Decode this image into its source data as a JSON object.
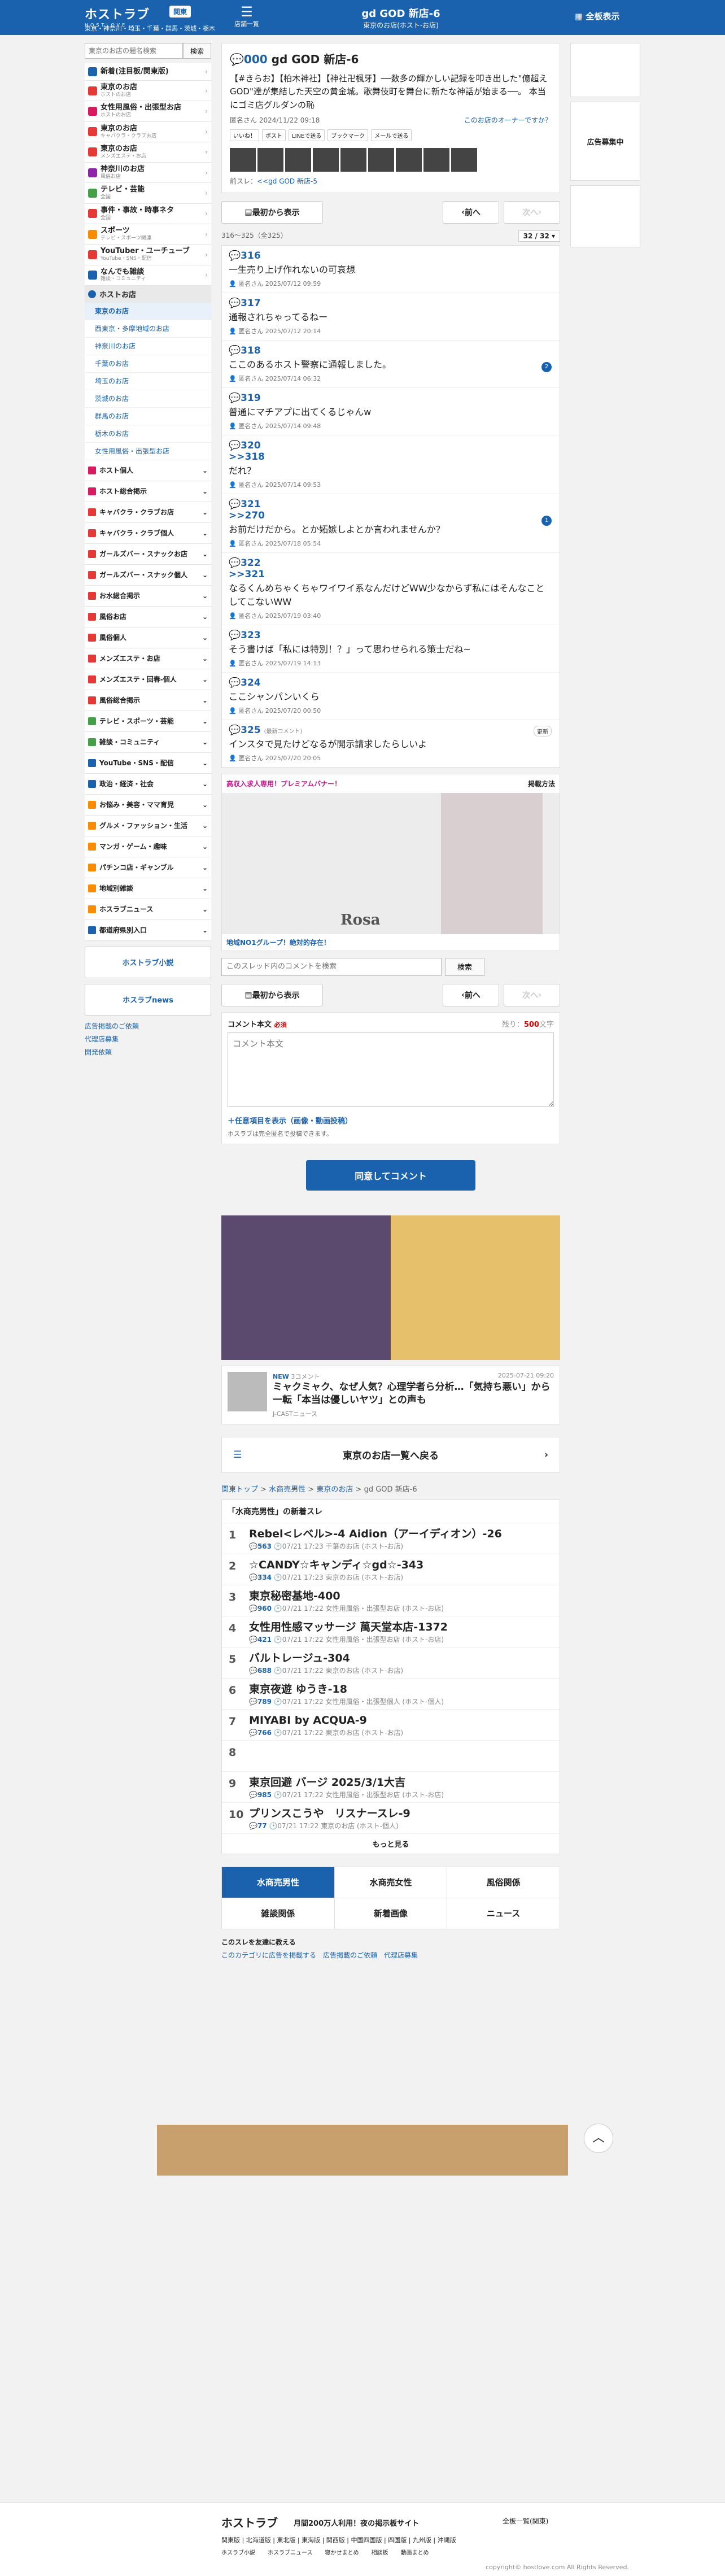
{
  "header": {
    "logo": "ホストラブ",
    "logo_sub": "HOSTLOVE",
    "area_badge": "関東",
    "areas": "東京・神奈川・埼玉・千葉・群馬・茨城・栃木",
    "menu_label": "店舗一覧",
    "title": "gd GOD 新店-6",
    "subtitle": "東京のお店(ホスト-お店)",
    "board": "全板表示"
  },
  "sidebar": {
    "search_placeholder": "東京のお店の題名検索",
    "search_btn": "検索",
    "categories": [
      {
        "name": "新着(注目板/関東版)",
        "color": "#1b62ae"
      },
      {
        "name": "東京のお店",
        "sub": "ホストのお店",
        "color": "#e53935"
      },
      {
        "name": "女性用風俗・出張型お店",
        "sub": "ホストのお店",
        "color": "#d81b60"
      },
      {
        "name": "東京のお店",
        "sub": "キャバクラ・クラブお店",
        "color": "#e53935"
      },
      {
        "name": "東京のお店",
        "sub": "メンズエステ・お店",
        "color": "#e53935"
      },
      {
        "name": "神奈川のお店",
        "sub": "風俗お店",
        "color": "#8e24aa"
      },
      {
        "name": "テレビ・芸能",
        "sub": "全国",
        "color": "#43a047"
      },
      {
        "name": "事件・事故・時事ネタ",
        "sub": "全国",
        "color": "#e53935"
      },
      {
        "name": "スポーツ",
        "sub": "テレビ・スポーツ関連",
        "color": "#fb8c00"
      },
      {
        "name": "YouTuber・ユーチューブ",
        "sub": "YouTube・SNS・配信",
        "color": "#e53935"
      },
      {
        "name": "なんでも雑談",
        "sub": "雑談・コミュニティ",
        "color": "#1b62ae"
      }
    ],
    "host_group": "ホストお店",
    "host_items": [
      "東京のお店",
      "西東京・多摩地域のお店",
      "神奈川のお店",
      "千葉のお店",
      "埼玉のお店",
      "茨城のお店",
      "群馬のお店",
      "栃木のお店",
      "女性用風俗・出張型お店"
    ],
    "groups": [
      {
        "name": "ホスト個人",
        "color": "#d81b60"
      },
      {
        "name": "ホスト総合掲示",
        "color": "#d81b60"
      },
      {
        "name": "キャバクラ・クラブお店",
        "color": "#e53935"
      },
      {
        "name": "キャバクラ・クラブ個人",
        "color": "#e53935"
      },
      {
        "name": "ガールズバー・スナックお店",
        "color": "#e53935"
      },
      {
        "name": "ガールズバー・スナック個人",
        "color": "#e53935"
      },
      {
        "name": "お水総合掲示",
        "color": "#e53935"
      },
      {
        "name": "風俗お店",
        "color": "#e53935"
      },
      {
        "name": "風俗個人",
        "color": "#e53935"
      },
      {
        "name": "メンズエステ・お店",
        "color": "#e53935"
      },
      {
        "name": "メンズエステ・回春-個人",
        "color": "#e53935"
      },
      {
        "name": "風俗総合掲示",
        "color": "#e53935"
      },
      {
        "name": "テレビ・スポーツ・芸能",
        "color": "#43a047"
      },
      {
        "name": "雑談・コミュニティ",
        "color": "#43a047"
      },
      {
        "name": "YouTube・SNS・配信",
        "color": "#1b62ae"
      },
      {
        "name": "政治・経済・社会",
        "color": "#1b62ae"
      },
      {
        "name": "お悩み・美容・ママ育児",
        "color": "#fb8c00"
      },
      {
        "name": "グルメ・ファッション・生活",
        "color": "#fb8c00"
      },
      {
        "name": "マンガ・ゲーム・趣味",
        "color": "#fb8c00"
      },
      {
        "name": "パチンコ店・ギャンブル",
        "color": "#fb8c00"
      },
      {
        "name": "地域別雑談",
        "color": "#fb8c00"
      },
      {
        "name": "ホスラブニュース",
        "color": "#fb8c00"
      },
      {
        "name": "都道府県別入口",
        "color": "#1b62ae"
      }
    ],
    "banner1": "ホストラブ小説",
    "banner2": "ホスラブnews",
    "links": [
      "広告掲載のご依頼",
      "代理店募集",
      "開発依頼"
    ]
  },
  "thread": {
    "number": "000",
    "title": "gd GOD 新店-6",
    "intro": "【#きらお】【柏木神社】【神社卍楓牙】──数多の輝かしい記録を叩き出した\"億超えGOD\"達が集結した天空の黄金城。歌舞伎町を舞台に新たな神話が始まる──。 本当にゴミ店グルダンの恥",
    "author": "匿名さん 2024/11/22 09:18",
    "owner": "このお店のオーナーですか？",
    "share": [
      "いいね！",
      "ポスト",
      "LINEで送る",
      "ブックマーク",
      "メールで送る"
    ],
    "prev_label": "前スレ",
    "prev_link": "<<gd GOD 新店-5"
  },
  "nav": {
    "first": "最初から表示",
    "prev": "前へ",
    "next": "次へ"
  },
  "count": {
    "text": "316〜325（全325）",
    "page": "32 / 32"
  },
  "posts": [
    {
      "no": "316",
      "body": "一生売り上げ作れないの可哀想",
      "info": "匿名さん 2025/07/12 09:59"
    },
    {
      "no": "317",
      "body": "通報されちゃってるねー",
      "info": "匿名さん 2025/07/12 20:14"
    },
    {
      "no": "318",
      "body": "ここのあるホスト警察に通報しました。",
      "info": "匿名さん 2025/07/14 06:32",
      "badge": "2"
    },
    {
      "no": "319",
      "body": "普通にマチアプに出てくるじゃんw",
      "info": "匿名さん 2025/07/14 09:48"
    },
    {
      "no": "320",
      "anchor": ">>318",
      "body": "だれ？",
      "info": "匿名さん 2025/07/14 09:53"
    },
    {
      "no": "321",
      "anchor": ">>270",
      "body": "お前だけだから。とか妬嫉しよとか言われませんか？",
      "info": "匿名さん 2025/07/18 05:54",
      "badge": "1"
    },
    {
      "no": "322",
      "anchor": ">>321",
      "body": "なるくんめちゃくちゃワイワイ系なんだけどWW少なからず私にはそんなことしてこないWW",
      "info": "匿名さん 2025/07/19 03:40"
    },
    {
      "no": "323",
      "body": "そう書けば「私には特別！？」って思わせられる策士だね~",
      "info": "匿名さん 2025/07/19 14:13"
    },
    {
      "no": "324",
      "body": "ここシャンパンいくら",
      "info": "匿名さん 2025/07/20 00:50"
    },
    {
      "no": "325",
      "note": "(最新コメント)",
      "body": "インスタで見たけどなるが開示請求したらしいよ",
      "info": "匿名さん 2025/07/20 20:05",
      "tag": "更新"
    }
  ],
  "ad": {
    "title": "高収入求人専用！プレミアムバナー！",
    "link": "掲載方法",
    "rosa": "Rosa",
    "footer": "地域NO1グループ！絶対的存在！"
  },
  "thread_search": {
    "placeholder": "このスレッド内のコメントを検索",
    "btn": "検索"
  },
  "comment": {
    "label": "コメント本文",
    "req": "必須",
    "remain": "残り：",
    "remain_num": "500",
    "unit": "文字",
    "placeholder": "コメント本文",
    "opt": "任意項目を表示（画像・動画投稿）",
    "note": "ホスラブは完全匿名で投稿できます。",
    "submit": "同意してコメント"
  },
  "news": {
    "badge": "NEW",
    "title": "ミャクミャク、なぜ人気？心理学者ら分析…「気持ち悪い」から一転「本当は優しいヤツ」との声も",
    "src": "J-CASTニュース",
    "date": "2025-07-21 09:20",
    "count": "3コメント"
  },
  "back": "東京のお店一覧へ戻る",
  "breadcrumb": [
    "関東トップ",
    "水商売男性",
    "東京のお店",
    "gd GOD 新店-6"
  ],
  "ranking": {
    "title": "「水商売男性」の新着スレ",
    "items": [
      {
        "n": "1",
        "t": "Rebel<レベル>-4 Aidion（アーイディオン）-26",
        "c": "563",
        "d": "07/21 17:23",
        "cat": "千葉のお店 (ホスト-お店)"
      },
      {
        "n": "2",
        "t": "☆CANDY☆キャンディ☆gd☆-343",
        "c": "334",
        "d": "07/21 17:23",
        "cat": "東京のお店 (ホスト-お店)"
      },
      {
        "n": "3",
        "t": "東京秘密基地-400",
        "c": "960",
        "d": "07/21 17:22",
        "cat": "女性用風俗・出張型お店 (ホスト-お店)"
      },
      {
        "n": "4",
        "t": "女性用性感マッサージ 萬天堂本店-1372",
        "c": "421",
        "d": "07/21 17:22",
        "cat": "女性用風俗・出張型お店 (ホスト-お店)"
      },
      {
        "n": "5",
        "t": "バルトレージュ-304",
        "c": "688",
        "d": "07/21 17:22",
        "cat": "東京のお店 (ホスト-お店)"
      },
      {
        "n": "6",
        "t": "東京夜遊 ゆうき-18",
        "c": "789",
        "d": "07/21 17:22",
        "cat": "女性用風俗・出張型個人 (ホスト-個人)"
      },
      {
        "n": "7",
        "t": "MIYABI by ACQUA-9",
        "c": "766",
        "d": "07/21 17:22",
        "cat": "東京のお店 (ホスト-お店)"
      },
      {
        "n": "8",
        "t": "",
        "c": "",
        "d": "",
        "cat": ""
      },
      {
        "n": "9",
        "t": "東京回避 バージ 2025/3/1大吉",
        "c": "985",
        "d": "07/21 17:22",
        "cat": "女性用風俗・出張型お店 (ホスト-お店)"
      },
      {
        "n": "10",
        "t": "プリンスこうや　リスナースレ-9",
        "c": "77",
        "d": "07/21 17:22",
        "cat": "東京のお店 (ホスト-個人)"
      }
    ],
    "more": "もっと見る"
  },
  "tabs": [
    "水商売男性",
    "水商売女性",
    "風俗関係",
    "雑談関係",
    "新着画像",
    "ニュース"
  ],
  "share_footer": {
    "label": "このスレを友達に教える",
    "links": [
      "このカテゴリに広告を掲載する",
      "広告掲載のご依頼",
      "代理店募集"
    ]
  },
  "footer": {
    "logo": "ホストラブ",
    "tag": "月間200万人利用！夜の掲示板サイト",
    "lang": "全板一覧(関東)",
    "areas": "関東版 | 北海道版 | 東北版 | 東海版 | 関西版 | 中国四国版 | 四国版 | 九州版 | 沖縄版",
    "icons": [
      "ホスラブ小説",
      "ホスラブニュース",
      "寝かせまとめ",
      "相談板",
      "動画まとめ"
    ],
    "copy": "copyright© hostlove.com All Rights Reserved."
  },
  "right": {
    "ad1": "広告募集中"
  }
}
